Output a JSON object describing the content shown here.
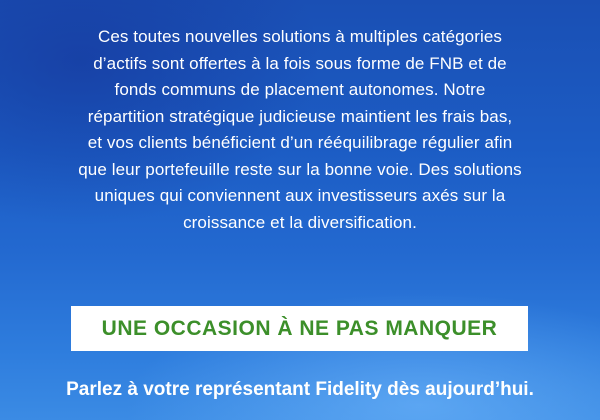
{
  "banner": {
    "body_lines": [
      "Ces toutes nouvelles solutions à multiples catégories",
      "d’actifs sont offertes à la fois sous forme de FNB et de",
      "fonds communs de placement autonomes. Notre",
      "répartition stratégique judicieuse maintient les frais bas,",
      "et vos clients bénéficient d’un rééquilibrage régulier afin",
      "que leur portefeuille reste sur la bonne voie. Des solutions",
      "uniques qui conviennent aux investisseurs axés sur la",
      "croissance et la diversification."
    ],
    "cta_label": "UNE OCCASION À NE PAS MANQUER",
    "footer": "Parlez à votre représentant Fidelity dès aujourd’hui."
  },
  "colors": {
    "background_top": "#1a4fb4",
    "background_bottom": "#3b8be4",
    "cta_background": "#ffffff",
    "cta_text": "#3c8f2a",
    "text": "#ffffff"
  }
}
